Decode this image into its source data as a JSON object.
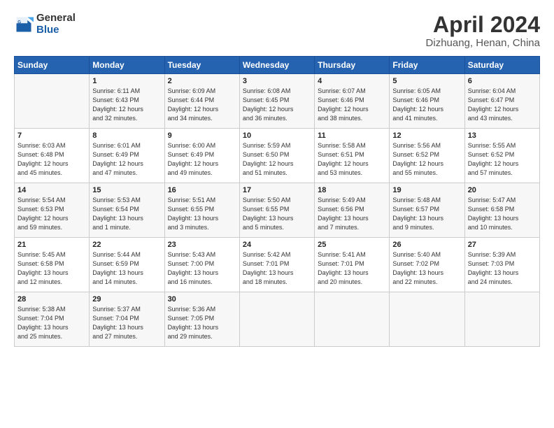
{
  "logo": {
    "general": "General",
    "blue": "Blue"
  },
  "header": {
    "month": "April 2024",
    "location": "Dizhuang, Henan, China"
  },
  "weekdays": [
    "Sunday",
    "Monday",
    "Tuesday",
    "Wednesday",
    "Thursday",
    "Friday",
    "Saturday"
  ],
  "weeks": [
    [
      {
        "day": "",
        "info": ""
      },
      {
        "day": "1",
        "info": "Sunrise: 6:11 AM\nSunset: 6:43 PM\nDaylight: 12 hours\nand 32 minutes."
      },
      {
        "day": "2",
        "info": "Sunrise: 6:09 AM\nSunset: 6:44 PM\nDaylight: 12 hours\nand 34 minutes."
      },
      {
        "day": "3",
        "info": "Sunrise: 6:08 AM\nSunset: 6:45 PM\nDaylight: 12 hours\nand 36 minutes."
      },
      {
        "day": "4",
        "info": "Sunrise: 6:07 AM\nSunset: 6:46 PM\nDaylight: 12 hours\nand 38 minutes."
      },
      {
        "day": "5",
        "info": "Sunrise: 6:05 AM\nSunset: 6:46 PM\nDaylight: 12 hours\nand 41 minutes."
      },
      {
        "day": "6",
        "info": "Sunrise: 6:04 AM\nSunset: 6:47 PM\nDaylight: 12 hours\nand 43 minutes."
      }
    ],
    [
      {
        "day": "7",
        "info": "Sunrise: 6:03 AM\nSunset: 6:48 PM\nDaylight: 12 hours\nand 45 minutes."
      },
      {
        "day": "8",
        "info": "Sunrise: 6:01 AM\nSunset: 6:49 PM\nDaylight: 12 hours\nand 47 minutes."
      },
      {
        "day": "9",
        "info": "Sunrise: 6:00 AM\nSunset: 6:49 PM\nDaylight: 12 hours\nand 49 minutes."
      },
      {
        "day": "10",
        "info": "Sunrise: 5:59 AM\nSunset: 6:50 PM\nDaylight: 12 hours\nand 51 minutes."
      },
      {
        "day": "11",
        "info": "Sunrise: 5:58 AM\nSunset: 6:51 PM\nDaylight: 12 hours\nand 53 minutes."
      },
      {
        "day": "12",
        "info": "Sunrise: 5:56 AM\nSunset: 6:52 PM\nDaylight: 12 hours\nand 55 minutes."
      },
      {
        "day": "13",
        "info": "Sunrise: 5:55 AM\nSunset: 6:52 PM\nDaylight: 12 hours\nand 57 minutes."
      }
    ],
    [
      {
        "day": "14",
        "info": "Sunrise: 5:54 AM\nSunset: 6:53 PM\nDaylight: 12 hours\nand 59 minutes."
      },
      {
        "day": "15",
        "info": "Sunrise: 5:53 AM\nSunset: 6:54 PM\nDaylight: 13 hours\nand 1 minute."
      },
      {
        "day": "16",
        "info": "Sunrise: 5:51 AM\nSunset: 6:55 PM\nDaylight: 13 hours\nand 3 minutes."
      },
      {
        "day": "17",
        "info": "Sunrise: 5:50 AM\nSunset: 6:55 PM\nDaylight: 13 hours\nand 5 minutes."
      },
      {
        "day": "18",
        "info": "Sunrise: 5:49 AM\nSunset: 6:56 PM\nDaylight: 13 hours\nand 7 minutes."
      },
      {
        "day": "19",
        "info": "Sunrise: 5:48 AM\nSunset: 6:57 PM\nDaylight: 13 hours\nand 9 minutes."
      },
      {
        "day": "20",
        "info": "Sunrise: 5:47 AM\nSunset: 6:58 PM\nDaylight: 13 hours\nand 10 minutes."
      }
    ],
    [
      {
        "day": "21",
        "info": "Sunrise: 5:45 AM\nSunset: 6:58 PM\nDaylight: 13 hours\nand 12 minutes."
      },
      {
        "day": "22",
        "info": "Sunrise: 5:44 AM\nSunset: 6:59 PM\nDaylight: 13 hours\nand 14 minutes."
      },
      {
        "day": "23",
        "info": "Sunrise: 5:43 AM\nSunset: 7:00 PM\nDaylight: 13 hours\nand 16 minutes."
      },
      {
        "day": "24",
        "info": "Sunrise: 5:42 AM\nSunset: 7:01 PM\nDaylight: 13 hours\nand 18 minutes."
      },
      {
        "day": "25",
        "info": "Sunrise: 5:41 AM\nSunset: 7:01 PM\nDaylight: 13 hours\nand 20 minutes."
      },
      {
        "day": "26",
        "info": "Sunrise: 5:40 AM\nSunset: 7:02 PM\nDaylight: 13 hours\nand 22 minutes."
      },
      {
        "day": "27",
        "info": "Sunrise: 5:39 AM\nSunset: 7:03 PM\nDaylight: 13 hours\nand 24 minutes."
      }
    ],
    [
      {
        "day": "28",
        "info": "Sunrise: 5:38 AM\nSunset: 7:04 PM\nDaylight: 13 hours\nand 25 minutes."
      },
      {
        "day": "29",
        "info": "Sunrise: 5:37 AM\nSunset: 7:04 PM\nDaylight: 13 hours\nand 27 minutes."
      },
      {
        "day": "30",
        "info": "Sunrise: 5:36 AM\nSunset: 7:05 PM\nDaylight: 13 hours\nand 29 minutes."
      },
      {
        "day": "",
        "info": ""
      },
      {
        "day": "",
        "info": ""
      },
      {
        "day": "",
        "info": ""
      },
      {
        "day": "",
        "info": ""
      }
    ]
  ]
}
